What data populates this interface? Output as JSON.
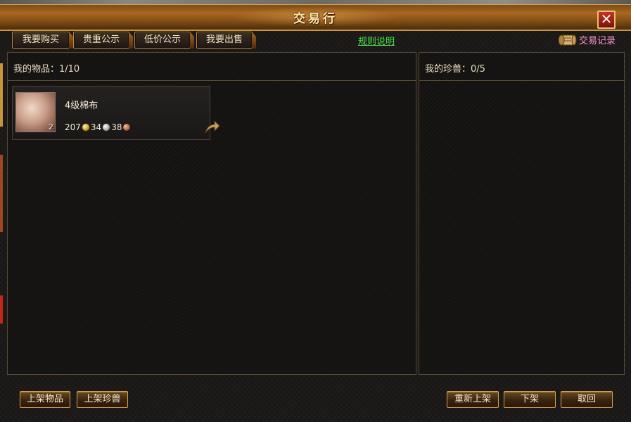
{
  "window": {
    "title": "交易行",
    "close_label": "✕"
  },
  "tabs": [
    {
      "label": "我要购买"
    },
    {
      "label": "贵重公示"
    },
    {
      "label": "低价公示"
    },
    {
      "label": "我要出售"
    }
  ],
  "rules_link": "规则说明",
  "records_label": "交易记录",
  "left_panel": {
    "header": "我的物品：1/10",
    "items": [
      {
        "name": "4级棉布",
        "quantity": "2",
        "price_gold": "207",
        "price_silver": "34",
        "price_copper": "38"
      }
    ]
  },
  "right_panel": {
    "header": "我的珍兽：0/5"
  },
  "bottom_buttons": {
    "list_item": "上架物品",
    "list_pet": "上架珍兽",
    "relist": "重新上架",
    "delist": "下架",
    "retrieve": "取回"
  },
  "colors": {
    "accent_gold": "#d8a04a",
    "link_green": "#4ee04a",
    "records_pink": "#ff9ad0",
    "close_red": "#c8302a"
  }
}
